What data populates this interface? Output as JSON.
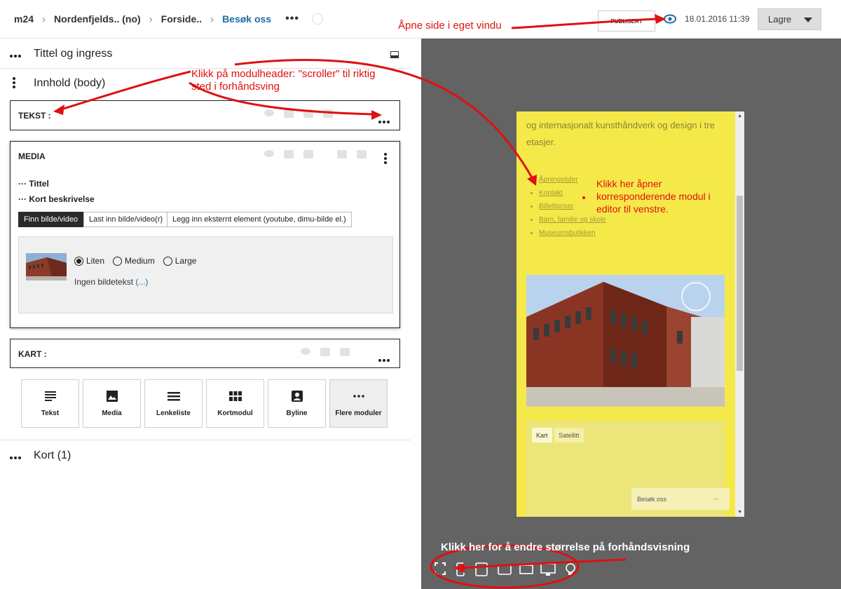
{
  "topbar": {
    "crumbs": [
      "m24",
      "Nordenfjelds.. (no)",
      "Forside..",
      "Besøk oss"
    ],
    "publish_label": "PUBLISERT",
    "timestamp": "18.01.2016 11:39",
    "save_label": "Lagre"
  },
  "editor": {
    "section_title": "Tittel og ingress",
    "section_body": "Innhold (body)",
    "section_kort": "Kort (1)",
    "module_tekst": "TEKST :",
    "module_media": "MEDIA",
    "module_kart": "KART :",
    "media": {
      "field_tittel": "Tittel",
      "field_kort": "Kort beskrivelse",
      "btn_find": "Finn bilde/video",
      "btn_upload": "Last inn bilde/video(r)",
      "btn_external": "Legg inn eksternt element (youtube, dimu-bilde el.)",
      "sizes": [
        "Liten",
        "Medium",
        "Large"
      ],
      "selected_size": "Liten",
      "caption": "Ingen bildetekst",
      "caption_link": "(...)"
    },
    "tiles": [
      "Tekst",
      "Media",
      "Lenkeliste",
      "Kortmodul",
      "Byline",
      "Flere moduler"
    ]
  },
  "preview": {
    "text": "og internasjonalt kunsthåndverk og design i tre etasjer.",
    "links": [
      "Åpningstider",
      "Kontakt",
      "Billettpriser",
      "Barn, familie og skole",
      "Museumsbutikken"
    ],
    "map_tabs": [
      "Kart",
      "Satellitt"
    ],
    "map_card": "Besøk oss",
    "map_card_more": "..."
  },
  "annotations": {
    "open_window": "Åpne side i eget vindu",
    "module_header": "Klikk på modulheader: \"scroller\" til riktig sted i  forhåndsving",
    "click_here": "Klikk her åpner korresponderende modul i editor til venstre.",
    "resize": "Klikk her for å endre størrelse på forhåndsvisning"
  },
  "colors": {
    "accent_link": "#1d6c9e",
    "annotation": "#e01010",
    "preview_bg": "#f5e94a"
  }
}
